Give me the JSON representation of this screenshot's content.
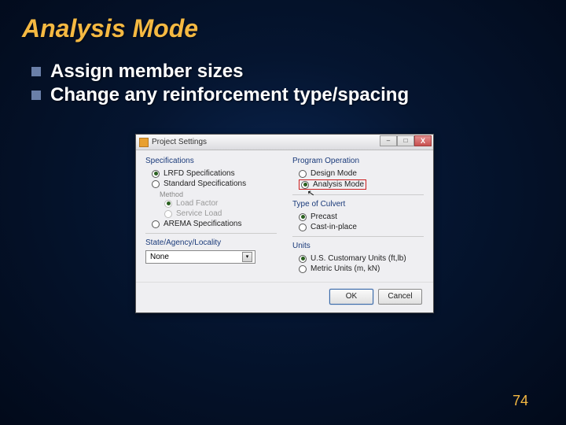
{
  "slide": {
    "title": "Analysis Mode",
    "bullets": [
      "Assign member sizes",
      "Change any reinforcement type/spacing"
    ],
    "page_number": "74"
  },
  "dialog": {
    "title": "Project Settings",
    "win_controls": {
      "min": "–",
      "max": "□",
      "close": "X"
    },
    "left": {
      "spec_label": "Specifications",
      "lrfd": "LRFD Specifications",
      "std": "Standard Specifications",
      "method_label": "Method",
      "load_factor": "Load Factor",
      "service_load": "Service Load",
      "arema": "AREMA Specifications",
      "locality_label": "State/Agency/Locality",
      "locality_value": "None"
    },
    "right": {
      "operation_label": "Program Operation",
      "design": "Design Mode",
      "analysis": "Analysis Mode",
      "culvert_label": "Type of Culvert",
      "precast": "Precast",
      "castinplace": "Cast-in-place",
      "units_label": "Units",
      "us_units": "U.S. Customary Units (ft,lb)",
      "metric_units": "Metric Units (m, kN)"
    },
    "buttons": {
      "ok": "OK",
      "cancel": "Cancel"
    }
  }
}
